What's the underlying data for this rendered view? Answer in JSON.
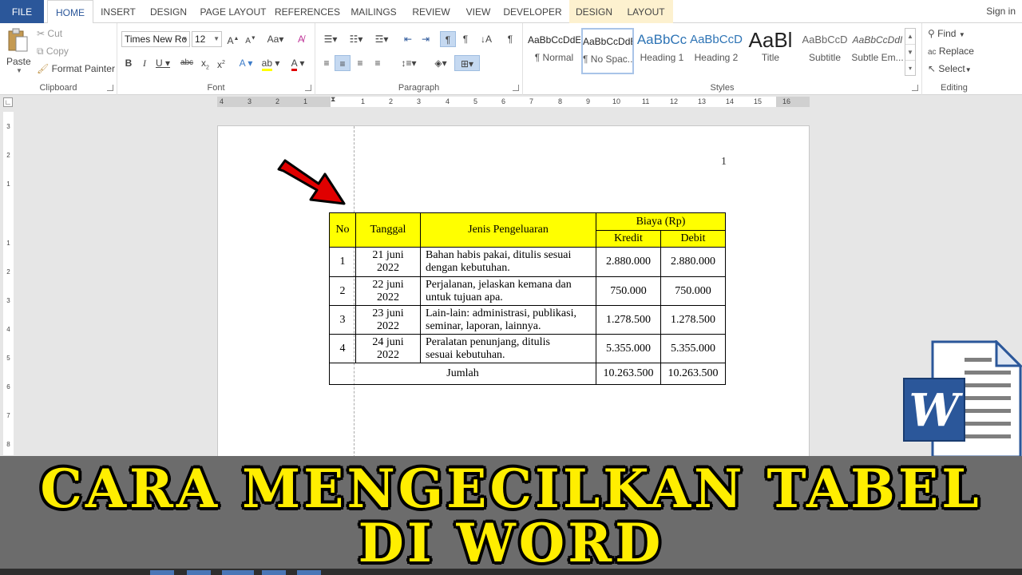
{
  "tabs": {
    "file": "FILE",
    "home": "HOME",
    "insert": "INSERT",
    "design": "DESIGN",
    "page_layout": "PAGE LAYOUT",
    "references": "REFERENCES",
    "mailings": "MAILINGS",
    "review": "REVIEW",
    "view": "VIEW",
    "developer": "DEVELOPER",
    "table_design": "DESIGN",
    "table_layout": "LAYOUT",
    "sign_in": "Sign in"
  },
  "clipboard": {
    "paste": "Paste",
    "cut": "Cut",
    "copy": "Copy",
    "format_painter": "Format Painter",
    "label": "Clipboard"
  },
  "font": {
    "name": "Times New Ro",
    "size": "12",
    "label": "Font"
  },
  "paragraph": {
    "label": "Paragraph"
  },
  "styles": {
    "label": "Styles",
    "items": [
      {
        "preview": "AaBbCcDdE",
        "name": "¶ Normal"
      },
      {
        "preview": "AaBbCcDdE",
        "name": "¶ No Spac..."
      },
      {
        "preview": "AaBbCc",
        "name": "Heading 1"
      },
      {
        "preview": "AaBbCcD",
        "name": "Heading 2"
      },
      {
        "preview": "AaBl",
        "name": "Title"
      },
      {
        "preview": "AaBbCcD",
        "name": "Subtitle"
      },
      {
        "preview": "AaBbCcDdI",
        "name": "Subtle Em..."
      }
    ]
  },
  "editing": {
    "find": "Find",
    "replace": "Replace",
    "select": "Select",
    "label": "Editing"
  },
  "ruler": {
    "ticks": [
      "4",
      "3",
      "2",
      "1",
      "1",
      "2",
      "3",
      "4",
      "5",
      "6",
      "7",
      "8",
      "9",
      "10",
      "11",
      "12",
      "13",
      "14",
      "15",
      "16"
    ]
  },
  "vruler": {
    "ticks": [
      "3",
      "2",
      "1",
      "1",
      "2",
      "3",
      "4",
      "5",
      "6",
      "7",
      "8"
    ]
  },
  "document": {
    "page_number": "1",
    "table": {
      "header": {
        "no": "No",
        "tanggal": "Tanggal",
        "jenis": "Jenis Pengeluaran",
        "biaya": "Biaya (Rp)",
        "kredit": "Kredit",
        "debit": "Debit"
      },
      "rows": [
        {
          "no": "1",
          "tanggal_1": "21 juni",
          "tanggal_2": "2022",
          "jenis_1": "Bahan habis pakai, ditulis sesuai",
          "jenis_2": "dengan kebutuhan.",
          "kredit": "2.880.000",
          "debit": "2.880.000"
        },
        {
          "no": "2",
          "tanggal_1": "22 juni",
          "tanggal_2": "2022",
          "jenis_1": "Perjalanan, jelaskan kemana dan",
          "jenis_2": "untuk tujuan apa.",
          "kredit": "750.000",
          "debit": "750.000"
        },
        {
          "no": "3",
          "tanggal_1": "23 juni",
          "tanggal_2": "2022",
          "jenis_1": "Lain-lain: administrasi, publikasi,",
          "jenis_2": "seminar, laporan, lainnya.",
          "kredit": "1.278.500",
          "debit": "1.278.500"
        },
        {
          "no": "4",
          "tanggal_1": "24 juni",
          "tanggal_2": "2022",
          "jenis_1": "Peralatan penunjang, ditulis",
          "jenis_2": "sesuai kebutuhan.",
          "kredit": "5.355.000",
          "debit": "5.355.000"
        }
      ],
      "total": {
        "label": "Jumlah",
        "kredit": "10.263.500",
        "debit": "10.263.500"
      }
    }
  },
  "banner": {
    "line1": "CARA MENGECILKAN TABEL",
    "line2": "DI WORD"
  },
  "logo": {
    "letter": "W"
  },
  "colors": {
    "word_blue": "#2b579a",
    "table_header": "#ffff00",
    "banner_text": "#ffee00",
    "banner_bg": "#6c6c6c",
    "arrow": "#e00000"
  }
}
